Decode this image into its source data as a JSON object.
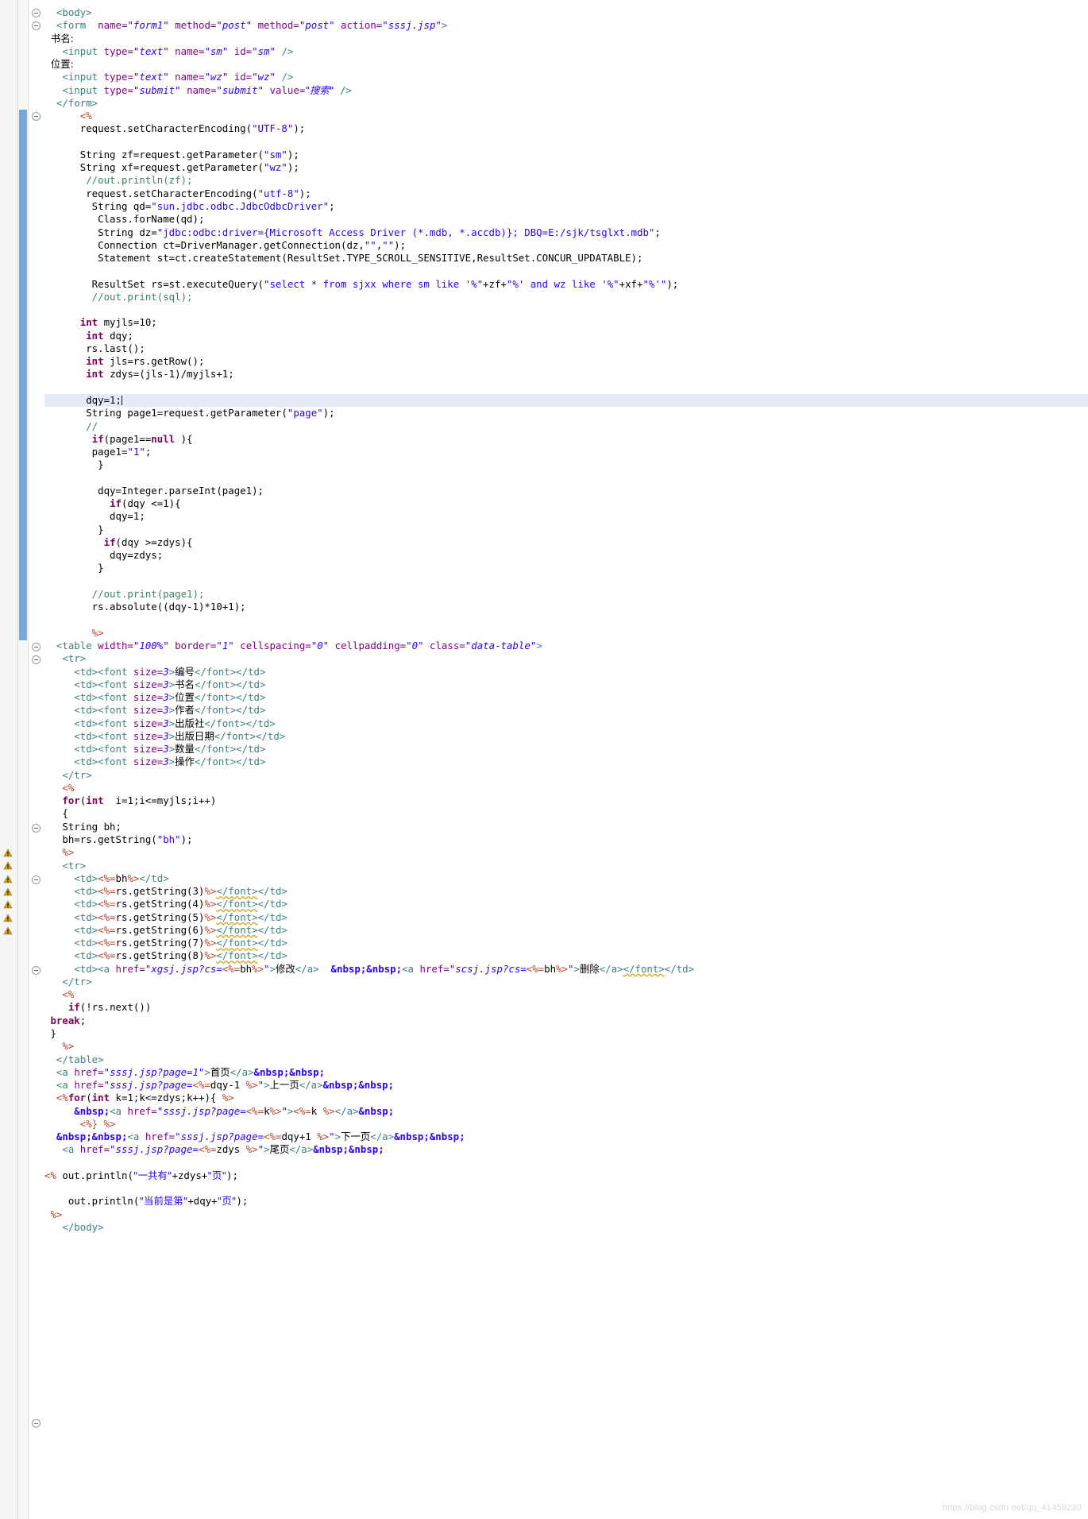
{
  "editor": {
    "language": "JSP",
    "watermark": "https://blog.csdn.net/qq_41459230",
    "highlighted_line_index": 30,
    "colors": {
      "tag": "#3f7f7f",
      "attribute": "#7f007f",
      "attribute_value": "#2a00ff",
      "string": "#2a00ff",
      "keyword": "#7f0055",
      "comment": "#3f7f5f",
      "scriptlet": "#b8482f",
      "highlight_row": "#e4edf7",
      "change_bar": "#7aa8d4",
      "warning_marker": "#d4a017"
    },
    "markers": {
      "fold_rows": [
        0,
        1,
        8,
        49,
        50,
        63,
        67,
        74,
        109
      ],
      "warning_rows": [
        65,
        66,
        67,
        68,
        69,
        70,
        71
      ],
      "change_bar_rows": [
        8,
        48
      ]
    }
  },
  "code_lines": [
    {
      "i": 0,
      "fold": true,
      "html": "<span class=\"tag\">  &lt;body&gt;</span>"
    },
    {
      "i": 1,
      "fold": true,
      "html": "<span class=\"tag\">  &lt;form</span>  <span class=\"attr\">name=</span><span class=\"val\">\"form1\"</span> <span class=\"attr\">method=</span><span class=\"val\">\"post\"</span> <span class=\"attr\">method=</span><span class=\"val\">\"post\"</span> <span class=\"attr\">action=</span><span class=\"val\">\"sssj.jsp\"</span><span class=\"tag\">&gt;</span>"
    },
    {
      "i": 2,
      "html": "<span class=\"plain cjk\">  书名:</span>"
    },
    {
      "i": 3,
      "html": "<span class=\"tag\">   &lt;input</span> <span class=\"attr\">type=</span><span class=\"val\">\"text\"</span> <span class=\"attr\">name=</span><span class=\"val\">\"sm\"</span> <span class=\"attr\">id=</span><span class=\"val\">\"sm\"</span> <span class=\"tag\">/&gt;</span>"
    },
    {
      "i": 4,
      "html": "<span class=\"plain cjk\">  位置:</span>"
    },
    {
      "i": 5,
      "html": "<span class=\"tag\">   &lt;input</span> <span class=\"attr\">type=</span><span class=\"val\">\"text\"</span> <span class=\"attr\">name=</span><span class=\"val\">\"wz\"</span> <span class=\"attr\">id=</span><span class=\"val\">\"wz\"</span> <span class=\"tag\">/&gt;</span>"
    },
    {
      "i": 6,
      "html": "<span class=\"tag\">   &lt;input</span> <span class=\"attr\">type=</span><span class=\"val\">\"submit\"</span> <span class=\"attr\">name=</span><span class=\"val\">\"submit\"</span> <span class=\"attr\">value=</span><span class=\"val cjk\">\"搜索\"</span> <span class=\"tag\">/&gt;</span>"
    },
    {
      "i": 7,
      "html": "<span class=\"tag\">  &lt;/form&gt;</span>"
    },
    {
      "i": 8,
      "fold": true,
      "html": "<span class=\"scriptlet\">      &lt;%</span>"
    },
    {
      "i": 9,
      "html": "<span class=\"plain\">      request.setCharacterEncoding(</span><span class=\"str\">\"UTF-8\"</span><span class=\"plain\">);</span>"
    },
    {
      "i": 10,
      "html": ""
    },
    {
      "i": 11,
      "html": "<span class=\"plain\">      String zf=request.getParameter(</span><span class=\"str\">\"sm\"</span><span class=\"plain\">);</span>"
    },
    {
      "i": 12,
      "html": "<span class=\"plain\">      String xf=request.getParameter(</span><span class=\"str\">\"wz\"</span><span class=\"plain\">);</span>"
    },
    {
      "i": 13,
      "html": "<span class=\"cmt\">       //out.println(zf);</span>"
    },
    {
      "i": 14,
      "html": "<span class=\"plain\">       request.setCharacterEncoding(</span><span class=\"str\">\"utf-8\"</span><span class=\"plain\">);</span>"
    },
    {
      "i": 15,
      "html": "<span class=\"plain\">        String qd=</span><span class=\"str\">\"sun.jdbc.odbc.JdbcOdbcDriver\"</span><span class=\"plain\">;</span>"
    },
    {
      "i": 16,
      "html": "<span class=\"plain\">         Class.forName(qd);</span>"
    },
    {
      "i": 17,
      "html": "<span class=\"plain\">         String dz=</span><span class=\"str\">\"jdbc:odbc:driver={Microsoft Access Driver (*.mdb, *.accdb)}; DBQ=E:/sjk/tsglxt.mdb\"</span><span class=\"plain\">;</span>"
    },
    {
      "i": 18,
      "html": "<span class=\"plain\">         Connection ct=DriverManager.getConnection(dz,</span><span class=\"str\">\"\"</span><span class=\"plain\">,</span><span class=\"str\">\"\"</span><span class=\"plain\">);</span>"
    },
    {
      "i": 19,
      "html": "<span class=\"plain\">         Statement st=ct.createStatement(ResultSet.TYPE_SCROLL_SENSITIVE,ResultSet.CONCUR_UPDATABLE);</span>"
    },
    {
      "i": 20,
      "html": ""
    },
    {
      "i": 21,
      "html": "<span class=\"plain\">        ResultSet rs=st.executeQuery(</span><span class=\"str\">\"select * from sjxx where sm like '%\"</span><span class=\"plain\">+zf+</span><span class=\"str\">\"%' and wz like '%\"</span><span class=\"plain\">+xf+</span><span class=\"str\">\"%'\"</span><span class=\"plain\">);</span>"
    },
    {
      "i": 22,
      "html": "<span class=\"cmt\">        //out.print(sql);</span>"
    },
    {
      "i": 23,
      "html": ""
    },
    {
      "i": 24,
      "html": "<span class=\"kw\">      int</span><span class=\"plain\"> myjls=10;</span>"
    },
    {
      "i": 25,
      "html": "<span class=\"kw\">       int</span><span class=\"plain\"> dqy;</span>"
    },
    {
      "i": 26,
      "html": "<span class=\"plain\">       rs.last();</span>"
    },
    {
      "i": 27,
      "html": "<span class=\"kw\">       int</span><span class=\"plain\"> jls=rs.getRow();</span>"
    },
    {
      "i": 28,
      "html": "<span class=\"kw\">       int</span><span class=\"plain\"> zdys=(jls-1)/myjls+1;</span>"
    },
    {
      "i": 29,
      "html": ""
    },
    {
      "i": 30,
      "hl": true,
      "html": "<span class=\"plain\">       dqy=1;</span><span class=\"caret\"></span>"
    },
    {
      "i": 31,
      "html": "<span class=\"plain\">       String page1=request.getParameter(</span><span class=\"str\">\"page\"</span><span class=\"plain\">);</span>"
    },
    {
      "i": 32,
      "html": "<span class=\"cmt\">       //</span>"
    },
    {
      "i": 33,
      "html": "<span class=\"plain\">        </span><span class=\"kw\">if</span><span class=\"plain\">(page1==</span><span class=\"kw\">null</span><span class=\"plain\"> ){</span>"
    },
    {
      "i": 34,
      "html": "<span class=\"plain\">        page1=</span><span class=\"str\">\"1\"</span><span class=\"plain\">;</span>"
    },
    {
      "i": 35,
      "html": "<span class=\"plain\">         }</span>"
    },
    {
      "i": 36,
      "html": ""
    },
    {
      "i": 37,
      "html": "<span class=\"plain\">         dqy=Integer.parseInt(page1);</span>"
    },
    {
      "i": 38,
      "html": "<span class=\"plain\">           </span><span class=\"kw\">if</span><span class=\"plain\">(dqy &lt;=1){</span>"
    },
    {
      "i": 39,
      "html": "<span class=\"plain\">           dqy=1;</span>"
    },
    {
      "i": 40,
      "html": "<span class=\"plain\">         }</span>"
    },
    {
      "i": 41,
      "html": "<span class=\"plain\">          </span><span class=\"kw\">if</span><span class=\"plain\">(dqy &gt;=zdys){</span>"
    },
    {
      "i": 42,
      "html": "<span class=\"plain\">           dqy=zdys;</span>"
    },
    {
      "i": 43,
      "html": "<span class=\"plain\">         }</span>"
    },
    {
      "i": 44,
      "html": ""
    },
    {
      "i": 45,
      "html": "<span class=\"cmt\">        //out.print(page1);</span>"
    },
    {
      "i": 46,
      "html": "<span class=\"plain\">        rs.absolute((dqy-1)*10+1);</span>"
    },
    {
      "i": 47,
      "html": ""
    },
    {
      "i": 48,
      "html": "<span class=\"scriptlet\">        %&gt;</span>"
    },
    {
      "i": 49,
      "fold": true,
      "html": "<span class=\"tag\">  &lt;table</span> <span class=\"attr\">width=</span><span class=\"val\">\"100%\"</span> <span class=\"attr\">border=</span><span class=\"val\">\"1\"</span> <span class=\"attr\">cellspacing=</span><span class=\"val\">\"0\"</span> <span class=\"attr\">cellpadding=</span><span class=\"val\">\"0\"</span> <span class=\"attr\">class=</span><span class=\"val\">\"data-table\"</span><span class=\"tag\">&gt;</span>"
    },
    {
      "i": 50,
      "fold": true,
      "html": "<span class=\"tag\">   &lt;tr&gt;</span>"
    },
    {
      "i": 51,
      "html": "<span class=\"tag\">     &lt;td&gt;&lt;font</span> <span class=\"attr\">size=</span><span class=\"val\">3</span><span class=\"tag\">&gt;</span><span class=\"plain cjk\">编号</span><span class=\"tag\">&lt;/font&gt;&lt;/td&gt;</span>"
    },
    {
      "i": 52,
      "html": "<span class=\"tag\">     &lt;td&gt;&lt;font</span> <span class=\"attr\">size=</span><span class=\"val\">3</span><span class=\"tag\">&gt;</span><span class=\"plain cjk\">书名</span><span class=\"tag\">&lt;/font&gt;&lt;/td&gt;</span>"
    },
    {
      "i": 53,
      "html": "<span class=\"tag\">     &lt;td&gt;&lt;font</span> <span class=\"attr\">size=</span><span class=\"val\">3</span><span class=\"tag\">&gt;</span><span class=\"plain cjk\">位置</span><span class=\"tag\">&lt;/font&gt;&lt;/td&gt;</span>"
    },
    {
      "i": 54,
      "html": "<span class=\"tag\">     &lt;td&gt;&lt;font</span> <span class=\"attr\">size=</span><span class=\"val\">3</span><span class=\"tag\">&gt;</span><span class=\"plain cjk\">作者</span><span class=\"tag\">&lt;/font&gt;&lt;/td&gt;</span>"
    },
    {
      "i": 55,
      "html": "<span class=\"tag\">     &lt;td&gt;&lt;font</span> <span class=\"attr\">size=</span><span class=\"val\">3</span><span class=\"tag\">&gt;</span><span class=\"plain cjk\">出版社</span><span class=\"tag\">&lt;/font&gt;&lt;/td&gt;</span>"
    },
    {
      "i": 56,
      "html": "<span class=\"tag\">     &lt;td&gt;&lt;font</span> <span class=\"attr\">size=</span><span class=\"val\">3</span><span class=\"tag\">&gt;</span><span class=\"plain cjk\">出版日期</span><span class=\"tag\">&lt;/font&gt;&lt;/td&gt;</span>"
    },
    {
      "i": 57,
      "fold": true,
      "html": "<span class=\"tag\">     &lt;td&gt;&lt;font</span> <span class=\"attr\">size=</span><span class=\"val\">3</span><span class=\"tag\">&gt;</span><span class=\"plain cjk\">数量</span><span class=\"tag\">&lt;/font&gt;&lt;/td&gt;</span>"
    },
    {
      "i": 58,
      "html": "<span class=\"tag\">     &lt;td&gt;&lt;font</span> <span class=\"attr\">size=</span><span class=\"val\">3</span><span class=\"tag\">&gt;</span><span class=\"plain cjk\">操作</span><span class=\"tag\">&lt;/font&gt;&lt;/td&gt;</span>"
    },
    {
      "i": 59,
      "html": "<span class=\"tag\">   &lt;/tr&gt;</span>"
    },
    {
      "i": 60,
      "html": "<span class=\"scriptlet\">   &lt;%</span>"
    },
    {
      "i": 61,
      "html": "<span class=\"plain\">   </span><span class=\"kw\">for</span><span class=\"plain\">(</span><span class=\"kw\">int</span><span class=\"plain\">  i=1;i&lt;=myjls;i++)</span>"
    },
    {
      "i": 62,
      "html": "<span class=\"plain\">   {</span>"
    },
    {
      "i": 63,
      "fold": true,
      "html": "<span class=\"plain\">   String bh;</span>"
    },
    {
      "i": 64,
      "html": "<span class=\"plain\">   bh=rs.getString(</span><span class=\"str\">\"bh\"</span><span class=\"plain\">);</span>"
    },
    {
      "i": 65,
      "html": "<span class=\"scriptlet\">   %&gt;</span>"
    },
    {
      "i": 66,
      "warn": true,
      "html": "<span class=\"tag\">   &lt;tr&gt;</span>"
    },
    {
      "i": 67,
      "warn": true,
      "html": "<span class=\"tag\">     &lt;td&gt;</span><span class=\"scriptlet\">&lt;%=</span><span class=\"plain\">bh</span><span class=\"scriptlet\">%&gt;</span><span class=\"tag\">&lt;/td&gt;</span>"
    },
    {
      "i": 68,
      "warn": true,
      "html": "<span class=\"tag\">     &lt;td&gt;</span><span class=\"scriptlet\">&lt;%=</span><span class=\"plain\">rs.getString(3)</span><span class=\"scriptlet\">%&gt;</span><span class=\"tag err\">&lt;/font&gt;</span><span class=\"tag\">&lt;/td&gt;</span>"
    },
    {
      "i": 69,
      "warn": true,
      "html": "<span class=\"tag\">     &lt;td&gt;</span><span class=\"scriptlet\">&lt;%=</span><span class=\"plain\">rs.getString(4)</span><span class=\"scriptlet\">%&gt;</span><span class=\"tag err\">&lt;/font&gt;</span><span class=\"tag\">&lt;/td&gt;</span>"
    },
    {
      "i": 70,
      "warn": true,
      "html": "<span class=\"tag\">     &lt;td&gt;</span><span class=\"scriptlet\">&lt;%=</span><span class=\"plain\">rs.getString(5)</span><span class=\"scriptlet\">%&gt;</span><span class=\"tag err\">&lt;/font&gt;</span><span class=\"tag\">&lt;/td&gt;</span>"
    },
    {
      "i": 71,
      "warn": true,
      "html": "<span class=\"tag\">     &lt;td&gt;</span><span class=\"scriptlet\">&lt;%=</span><span class=\"plain\">rs.getString(6)</span><span class=\"scriptlet\">%&gt;</span><span class=\"tag err\">&lt;/font&gt;</span><span class=\"tag\">&lt;/td&gt;</span>"
    },
    {
      "i": 72,
      "html": "<span class=\"tag\">     &lt;td&gt;</span><span class=\"scriptlet\">&lt;%=</span><span class=\"plain\">rs.getString(7)</span><span class=\"scriptlet\">%&gt;</span><span class=\"tag err\">&lt;/font&gt;</span><span class=\"tag\">&lt;/td&gt;</span>"
    },
    {
      "i": 73,
      "fold": true,
      "html": "<span class=\"tag\">     &lt;td&gt;</span><span class=\"scriptlet\">&lt;%=</span><span class=\"plain\">rs.getString(8)</span><span class=\"scriptlet\">%&gt;</span><span class=\"tag err\">&lt;/font&gt;</span><span class=\"tag\">&lt;/td&gt;</span>"
    },
    {
      "i": 74,
      "html": "<span class=\"tag\">     &lt;td&gt;&lt;a</span> <span class=\"attr\">href=</span><span class=\"val\">\"xgsj.jsp?cs=</span><span class=\"scriptlet\">&lt;%=</span><span class=\"plain\">bh</span><span class=\"scriptlet\">%&gt;</span><span class=\"val\">\"</span><span class=\"tag\">&gt;</span><span class=\"plain cjk\">修改</span><span class=\"tag\">&lt;/a&gt;</span><span class=\"plain\">  </span><span class=\"ent\">&amp;nbsp;&amp;nbsp;</span><span class=\"tag\">&lt;a</span> <span class=\"attr\">href=</span><span class=\"val\">\"scsj.jsp?cs=</span><span class=\"scriptlet\">&lt;%=</span><span class=\"plain\">bh</span><span class=\"scriptlet\">%&gt;</span><span class=\"val\">\"</span><span class=\"tag\">&gt;</span><span class=\"plain cjk\">删除</span><span class=\"tag\">&lt;/a&gt;</span><span class=\"tag err\">&lt;/font&gt;</span><span class=\"tag\">&lt;/td&gt;</span>"
    },
    {
      "i": 75,
      "html": "<span class=\"tag\">   &lt;/tr&gt;</span>"
    },
    {
      "i": 76,
      "html": "<span class=\"scriptlet\">   &lt;%</span>"
    },
    {
      "i": 77,
      "html": "<span class=\"plain\">    </span><span class=\"kw\">if</span><span class=\"plain\">(!rs.next())</span>"
    },
    {
      "i": 78,
      "html": "<span class=\"kw\"> break</span><span class=\"plain\">;</span>"
    },
    {
      "i": 79,
      "html": "<span class=\"plain\"> }</span>"
    },
    {
      "i": 80,
      "html": "<span class=\"scriptlet\">   %&gt;</span>"
    },
    {
      "i": 81,
      "html": "<span class=\"tag\">  &lt;/table&gt;</span>"
    },
    {
      "i": 82,
      "html": "<span class=\"tag\">  &lt;a</span> <span class=\"attr\">href=</span><span class=\"val\">\"sssj.jsp?page=1\"</span><span class=\"tag\">&gt;</span><span class=\"plain cjk\">首页</span><span class=\"tag\">&lt;/a&gt;</span><span class=\"ent\">&amp;nbsp;&amp;nbsp;</span>"
    },
    {
      "i": 83,
      "html": "<span class=\"tag\">  &lt;a</span> <span class=\"attr\">href=</span><span class=\"val\">\"sssj.jsp?page=</span><span class=\"scriptlet\">&lt;%=</span><span class=\"plain\">dqy-1 </span><span class=\"scriptlet\">%&gt;</span><span class=\"val\">\"</span><span class=\"tag\">&gt;</span><span class=\"plain cjk\">上一页</span><span class=\"tag\">&lt;/a&gt;</span><span class=\"ent\">&amp;nbsp;&amp;nbsp;</span>"
    },
    {
      "i": 84,
      "html": "<span class=\"scriptlet\">  &lt;%</span><span class=\"kw\">for</span><span class=\"plain\">(</span><span class=\"kw\">int</span><span class=\"plain\"> k=1;k&lt;=zdys;k++){ </span><span class=\"scriptlet\">%&gt;</span>"
    },
    {
      "i": 85,
      "html": "<span class=\"ent\">     &amp;nbsp;</span><span class=\"tag\">&lt;a</span> <span class=\"attr\">href=</span><span class=\"val\">\"sssj.jsp?page=</span><span class=\"scriptlet\">&lt;%=</span><span class=\"plain\">k</span><span class=\"scriptlet\">%&gt;</span><span class=\"val\">\"</span><span class=\"tag\">&gt;</span><span class=\"scriptlet\">&lt;%=</span><span class=\"plain\">k </span><span class=\"scriptlet\">%&gt;</span><span class=\"tag\">&lt;/a&gt;</span><span class=\"ent\">&amp;nbsp;</span>"
    },
    {
      "i": 86,
      "html": "<span class=\"scriptlet\">      &lt;%} %&gt;</span>"
    },
    {
      "i": 87,
      "html": "<span class=\"ent\">  &amp;nbsp;&amp;nbsp;</span><span class=\"tag\">&lt;a</span> <span class=\"attr\">href=</span><span class=\"val\">\"sssj.jsp?page=</span><span class=\"scriptlet\">&lt;%=</span><span class=\"plain\">dqy+1 </span><span class=\"scriptlet\">%&gt;</span><span class=\"val\">\"</span><span class=\"tag\">&gt;</span><span class=\"plain cjk\">下一页</span><span class=\"tag\">&lt;/a&gt;</span><span class=\"ent\">&amp;nbsp;&amp;nbsp;</span>"
    },
    {
      "i": 88,
      "html": "<span class=\"tag\">   &lt;a</span> <span class=\"attr\">href=</span><span class=\"val\">\"sssj.jsp?page=</span><span class=\"scriptlet\">&lt;%=</span><span class=\"plain\">zdys </span><span class=\"scriptlet\">%&gt;</span><span class=\"val\">\"</span><span class=\"tag\">&gt;</span><span class=\"plain cjk\">尾页</span><span class=\"tag\">&lt;/a&gt;</span><span class=\"ent\">&amp;nbsp;&amp;nbsp;</span>"
    },
    {
      "i": 89,
      "html": ""
    },
    {
      "i": 90,
      "fold": true,
      "html": "<span class=\"scriptlet\">&lt;%</span><span class=\"plain\"> out.println(</span><span class=\"str cjk\">\"一共有\"</span><span class=\"plain\">+zdys+</span><span class=\"str cjk\">\"页\"</span><span class=\"plain\">);</span>"
    },
    {
      "i": 91,
      "html": ""
    },
    {
      "i": 92,
      "html": "<span class=\"plain\">    out.println(</span><span class=\"str cjk\">\"当前是第\"</span><span class=\"plain\">+dqy+</span><span class=\"str cjk\">\"页\"</span><span class=\"plain\">);</span>"
    },
    {
      "i": 93,
      "html": "<span class=\"scriptlet\"> %&gt;</span>"
    },
    {
      "i": 94,
      "html": "<span class=\"tag\">   &lt;/body&gt;</span>"
    }
  ]
}
